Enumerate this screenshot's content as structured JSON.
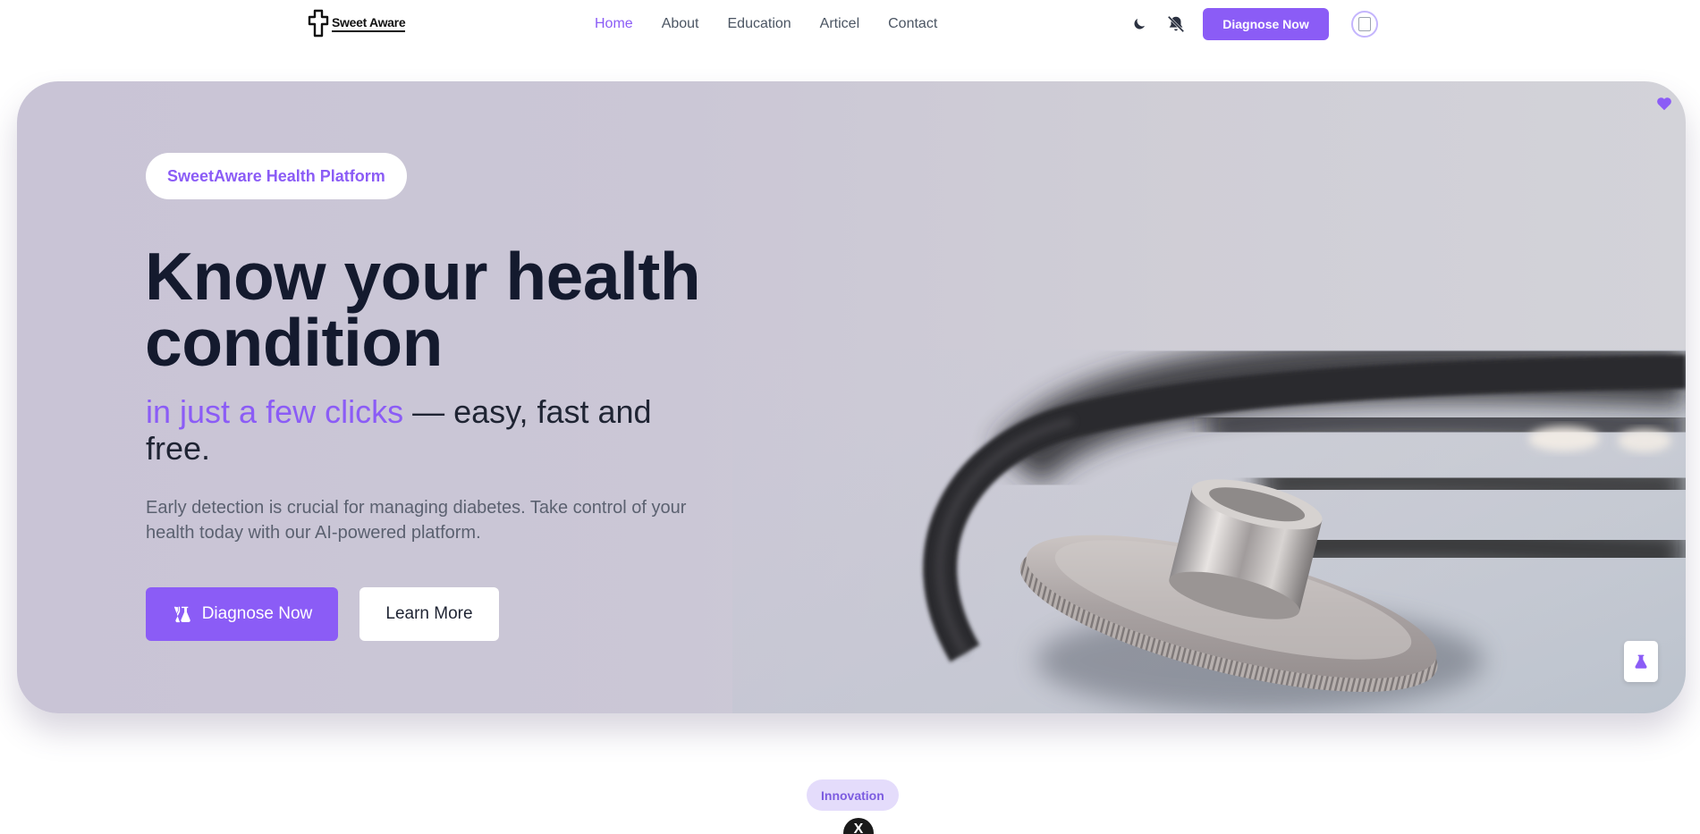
{
  "brand": {
    "name": "Sweet Aware",
    "accent_color": "#8b5cf6"
  },
  "nav": {
    "links": [
      {
        "label": "Home",
        "active": true
      },
      {
        "label": "About",
        "active": false
      },
      {
        "label": "Education",
        "active": false
      },
      {
        "label": "Articel",
        "active": false
      },
      {
        "label": "Contact",
        "active": false
      }
    ],
    "icons": [
      "moon-icon",
      "bell-off-icon"
    ],
    "cta_label": "Diagnose Now"
  },
  "hero": {
    "badge": "SweetAware Health Platform",
    "headline": "Know your health condition",
    "subline_accent": "in just a few clicks",
    "subline_rest": " — easy, fast and free.",
    "description": "Early detection is crucial for managing diabetes. Take control of your health today with our AI-powered platform.",
    "primary_button": "Diagnose Now",
    "secondary_button": "Learn More",
    "image": "stethoscope"
  },
  "section": {
    "badge": "Innovation",
    "icon_letter": "X"
  }
}
